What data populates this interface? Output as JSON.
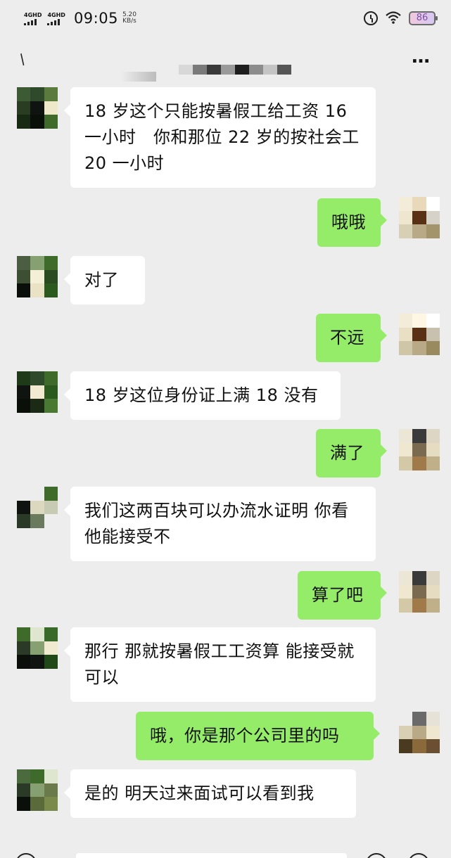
{
  "status_bar": {
    "network_1": "4GHD",
    "network_2": "4GHD",
    "time": "09:05",
    "speed_value": "5.20",
    "speed_unit": "KB/s",
    "battery": "86",
    "icons": [
      "alarm-icon",
      "wifi-icon",
      "battery-icon"
    ]
  },
  "nav": {
    "back_icon": "back-icon",
    "more_label": "…"
  },
  "messages": [
    {
      "side": "in",
      "text": "18 岁这个只能按暑假工给工资 16 一小时　你和那位 22 岁的按社会工 20 一小时"
    },
    {
      "side": "out",
      "text": "哦哦"
    },
    {
      "side": "in",
      "text": "对了"
    },
    {
      "side": "out",
      "text": "不远"
    },
    {
      "side": "in",
      "text": "18 岁这位身份证上满 18 没有"
    },
    {
      "side": "out",
      "text": "满了"
    },
    {
      "side": "in",
      "text": "我们这两百块可以办流水证明 你看他能接受不"
    },
    {
      "side": "out",
      "text": "算了吧"
    },
    {
      "side": "in",
      "text": "那行 那就按暑假工工资算 能接受就可以"
    },
    {
      "side": "out",
      "text": "哦，你是那个公司里的吗"
    },
    {
      "side": "in",
      "text": "是的 明天过来面试可以看到我"
    }
  ]
}
